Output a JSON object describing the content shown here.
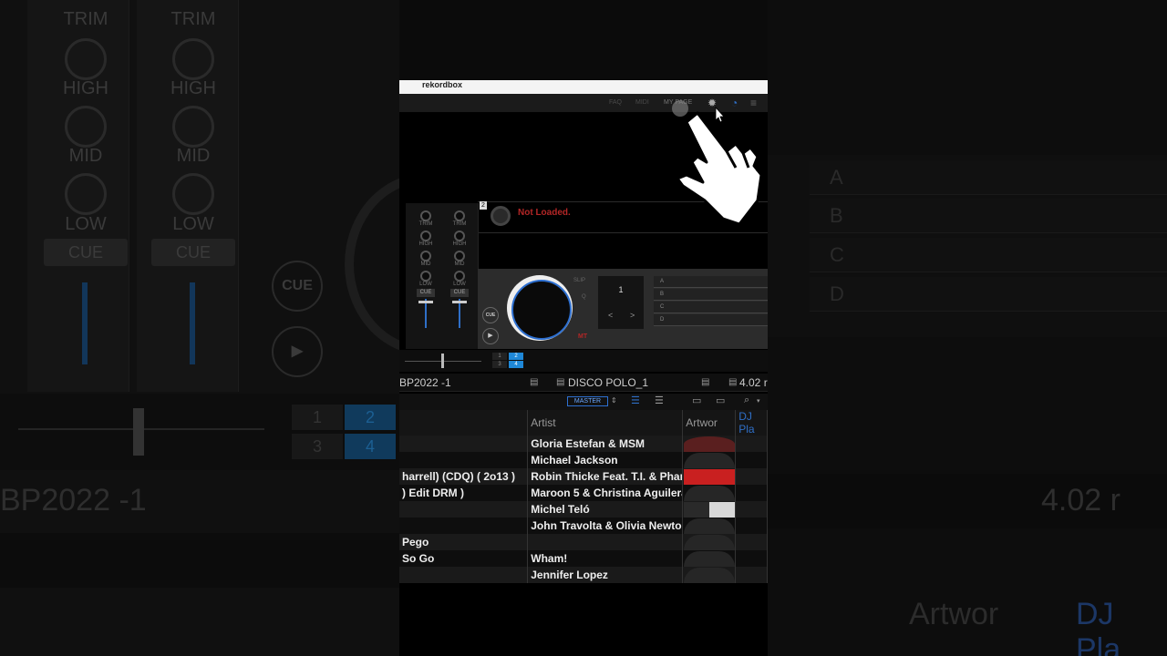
{
  "app": {
    "title": "rekordbox"
  },
  "topbar": {
    "faq": "FAQ",
    "midi": "MIDI",
    "mypage": "MY PAGE"
  },
  "deck2": {
    "number": "2",
    "status": "Not Loaded."
  },
  "mixer": {
    "labels": {
      "trim": "TRIM",
      "high": "HIGH",
      "mid": "MID",
      "low": "LOW",
      "cue": "CUE"
    }
  },
  "jog": {
    "cue": "CUE",
    "play": "▶",
    "slip": "SLIP",
    "q": "Q",
    "mt": "MT"
  },
  "beat": {
    "value": "1",
    "prev": "<",
    "next": ">"
  },
  "hotcues": [
    "A",
    "B",
    "C",
    "D"
  ],
  "deck_buttons": [
    "1",
    "2",
    "3",
    "4"
  ],
  "browser": {
    "left_title": "BP2022 -1",
    "playlist_title": "DISCO POLO_1",
    "right_title": "4.02 r",
    "master_label": "MASTER"
  },
  "columns": {
    "title": "",
    "artist": "Artist",
    "artwork": "Artwor",
    "djplay": "DJ Pla"
  },
  "tracks": [
    {
      "title": "",
      "artist": "Gloria Estefan & MSM",
      "art": "dark"
    },
    {
      "title": "",
      "artist": "Michael Jackson",
      "art": ""
    },
    {
      "title": "harrell) (CDQ) ( 2o13 )",
      "artist": "Robin Thicke Feat. T.I. & Phar",
      "art": "red"
    },
    {
      "title": ") Edit DRM )",
      "artist": "Maroon 5 & Christina Aguilera",
      "art": ""
    },
    {
      "title": "",
      "artist": "Michel Teló",
      "art": "split"
    },
    {
      "title": "",
      "artist": "John Travolta & Olivia Newton",
      "art": ""
    },
    {
      "title": "Pego",
      "artist": "",
      "art": ""
    },
    {
      "title": "So Go",
      "artist": "Wham!",
      "art": ""
    },
    {
      "title": "",
      "artist": "Jennifer Lopez",
      "art": ""
    }
  ],
  "background": {
    "trim": "TRIM",
    "high": "HIGH",
    "mid": "MID",
    "low": "LOW",
    "cue": "CUE",
    "left_title": "BP2022 -1",
    "right_title": "4.02 r",
    "pads": [
      "A",
      "B",
      "C",
      "D"
    ],
    "artwork": "Artwor",
    "djplay": "DJ Pla"
  }
}
